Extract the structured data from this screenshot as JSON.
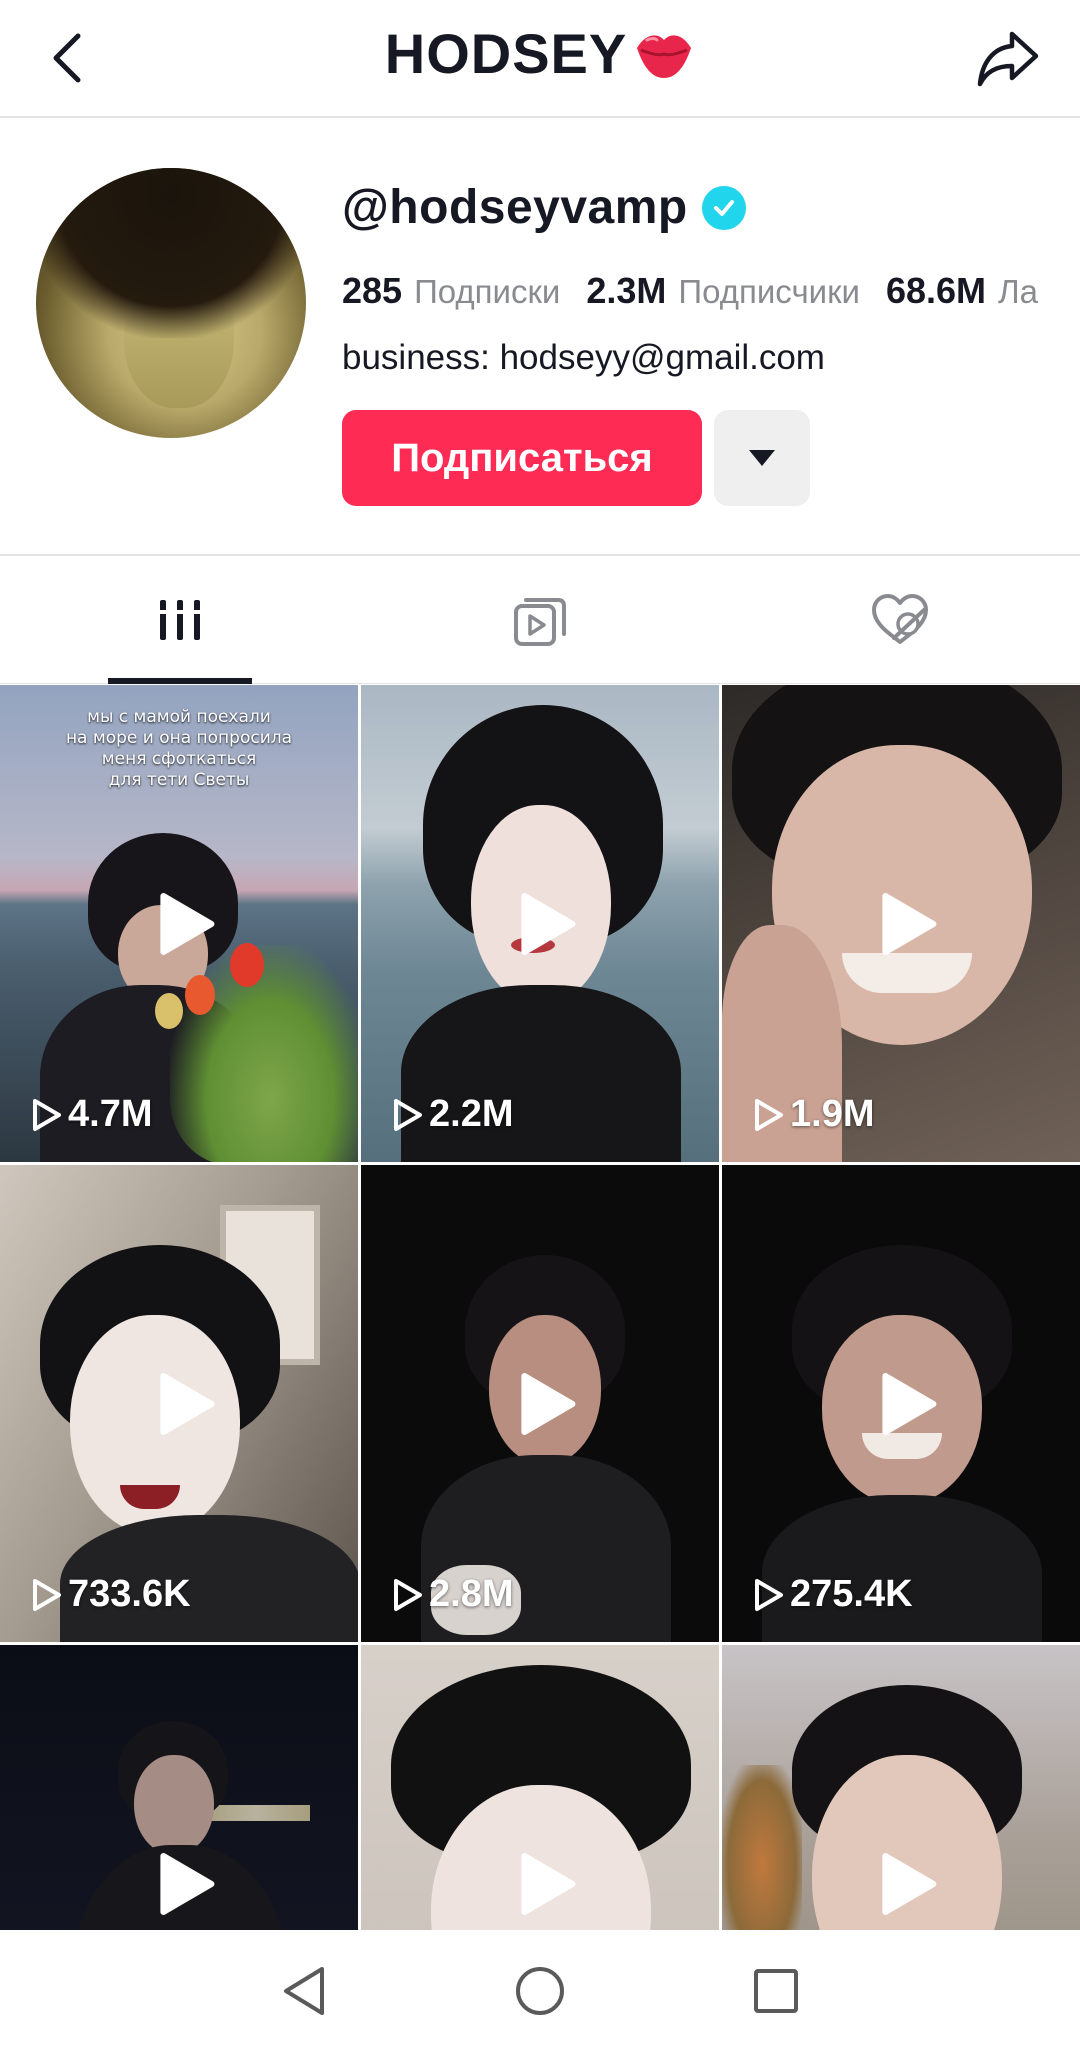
{
  "header": {
    "title": "HODSEY"
  },
  "profile": {
    "username": "@hodseyvamp",
    "stats": [
      {
        "value": "285",
        "label": "Подписки"
      },
      {
        "value": "2.3M",
        "label": "Подписчики"
      },
      {
        "value": "68.6M",
        "label": "Ла"
      }
    ],
    "bio": "business: hodseyy@gmail.com",
    "follow_label": "Подписаться"
  },
  "tabs": [
    {
      "name": "videos",
      "icon": "grid-icon",
      "active": true
    },
    {
      "name": "reposts",
      "icon": "repost-icon",
      "active": false
    },
    {
      "name": "liked",
      "icon": "liked-hidden-icon",
      "active": false
    }
  ],
  "videos": [
    {
      "views": "4.7M",
      "caption": "мы с мамой поехали\nна море и она попросила\nменя сфоткаться\nдля тети Светы"
    },
    {
      "views": "2.2M"
    },
    {
      "views": "1.9M"
    },
    {
      "views": "733.6K"
    },
    {
      "views": "2.8M"
    },
    {
      "views": "275.4K"
    },
    {
      "views": ""
    },
    {
      "views": ""
    },
    {
      "views": ""
    }
  ],
  "colors": {
    "accent": "#fe2c55",
    "verified": "#20d5ec",
    "text": "#161823",
    "muted": "#8a8b91"
  }
}
